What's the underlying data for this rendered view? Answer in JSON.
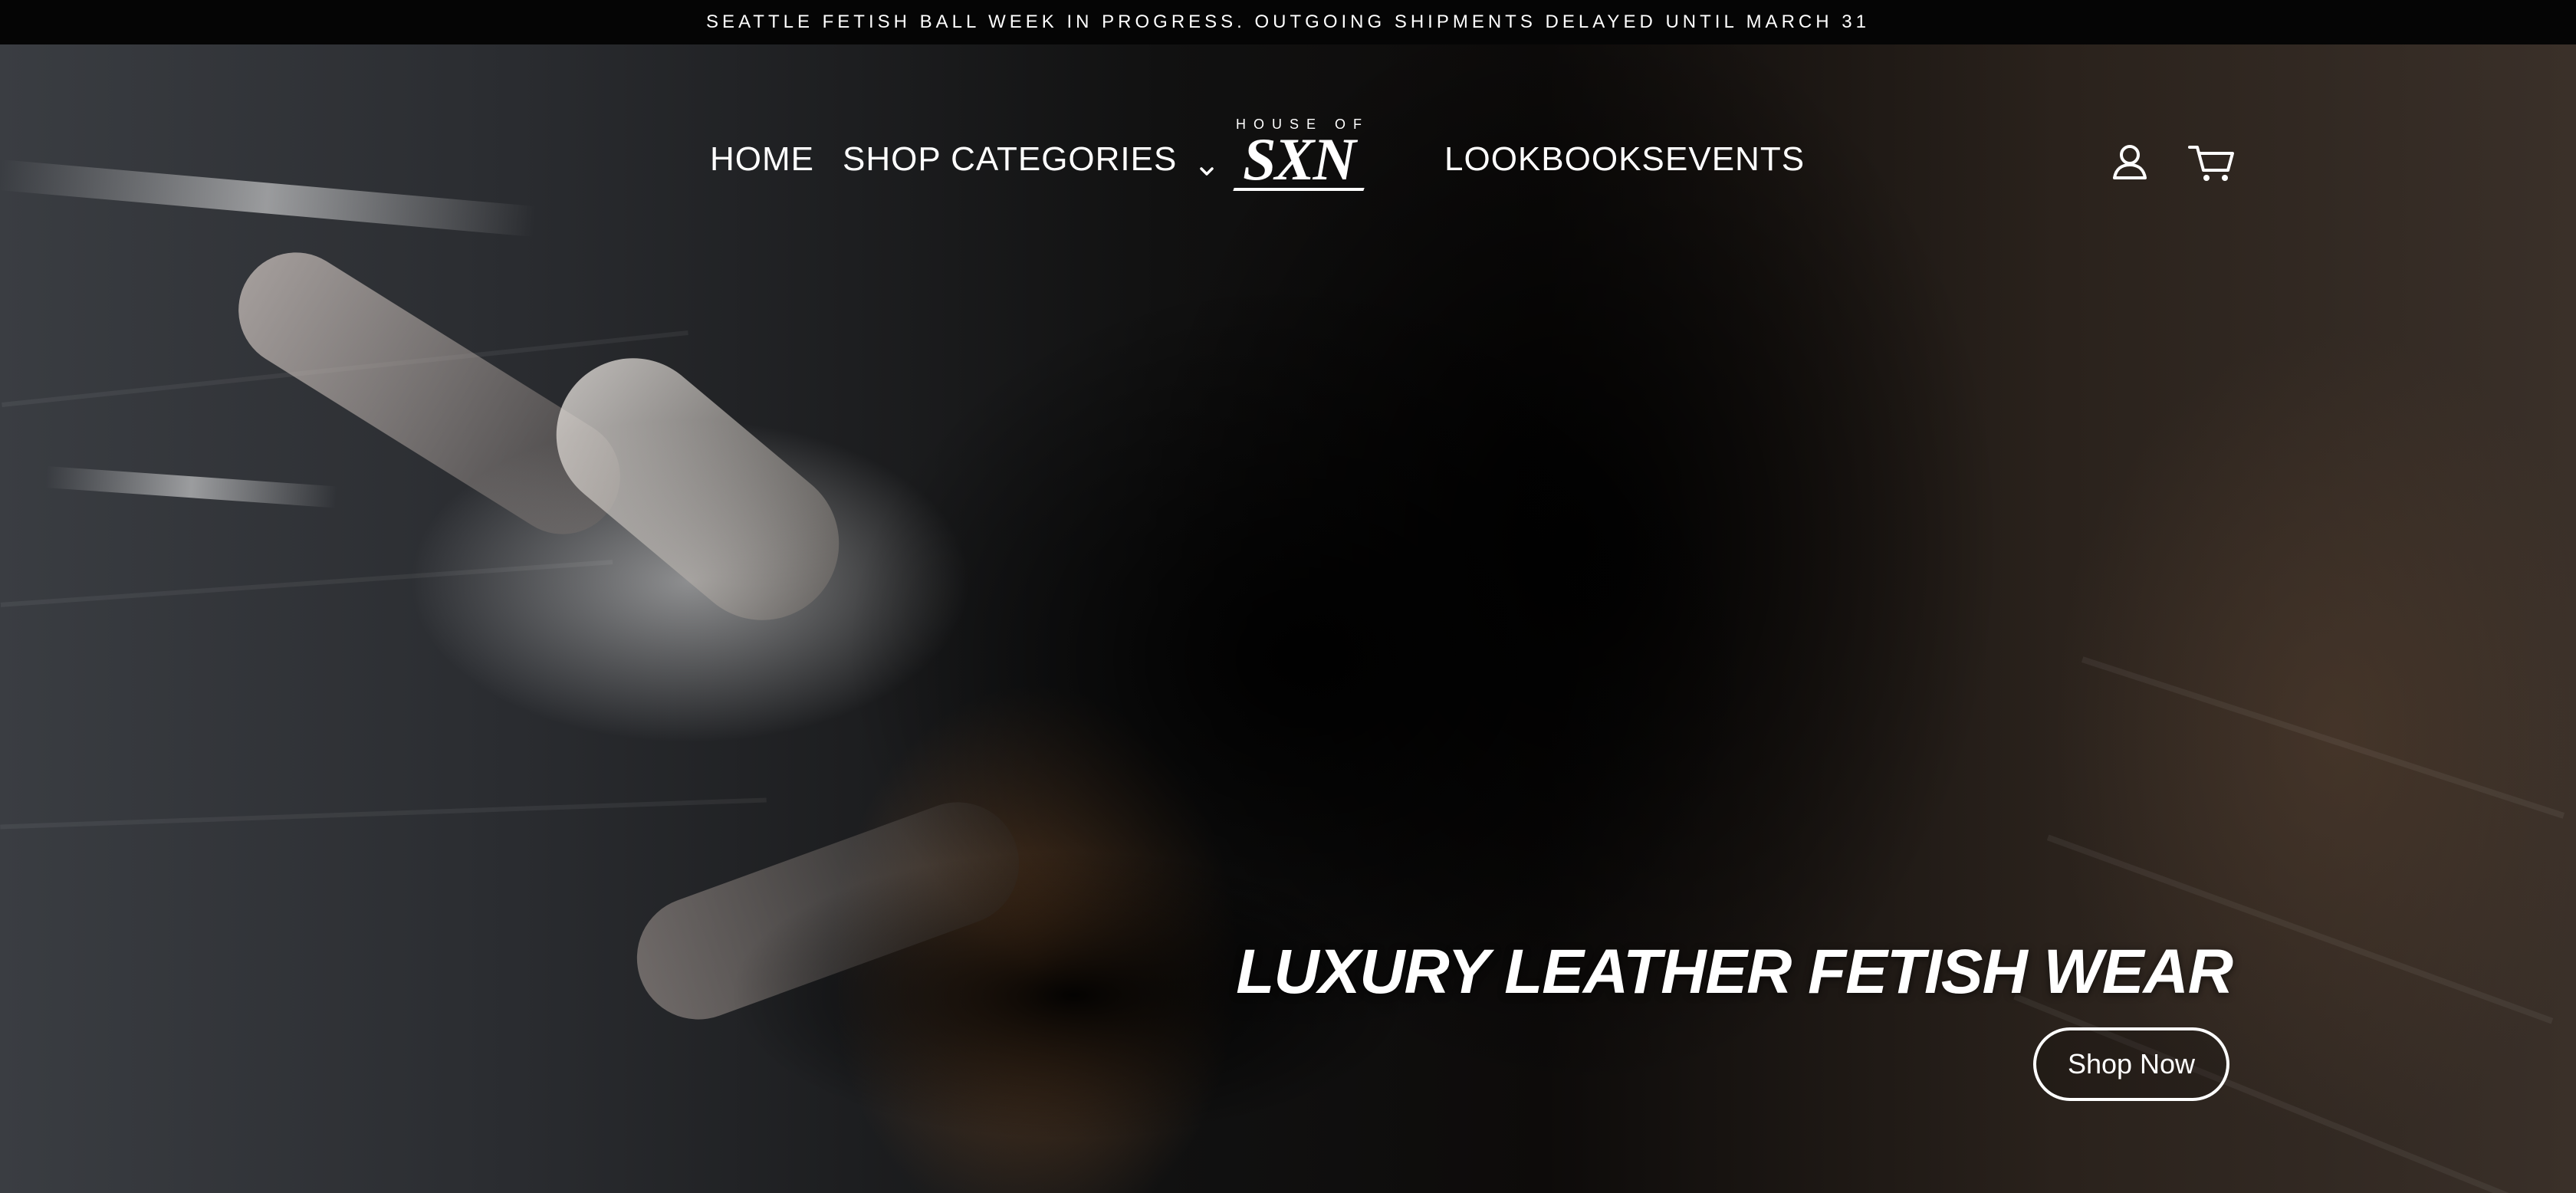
{
  "announcement": {
    "text": "SEATTLE FETISH BALL WEEK IN PROGRESS. OUTGOING SHIPMENTS DELAYED UNTIL MARCH 31"
  },
  "header": {
    "nav_left": [
      {
        "label": "HOME"
      },
      {
        "label": "SHOP CATEGORIES",
        "has_dropdown": true
      }
    ],
    "logo": {
      "top_text": "HOUSE OF",
      "main_text": "SXN"
    },
    "nav_right": [
      {
        "label": "LOOKBOOKS"
      },
      {
        "label": "EVENTS"
      }
    ],
    "icons": {
      "account": "user-icon",
      "cart": "cart-icon"
    }
  },
  "hero": {
    "title": "LUXURY LEATHER FETISH WEAR",
    "button_label": "Shop Now",
    "image": "hero-photo"
  },
  "colors": {
    "announcement_bg": "#050505",
    "text": "#ffffff",
    "accent_border": "#ffffff"
  }
}
